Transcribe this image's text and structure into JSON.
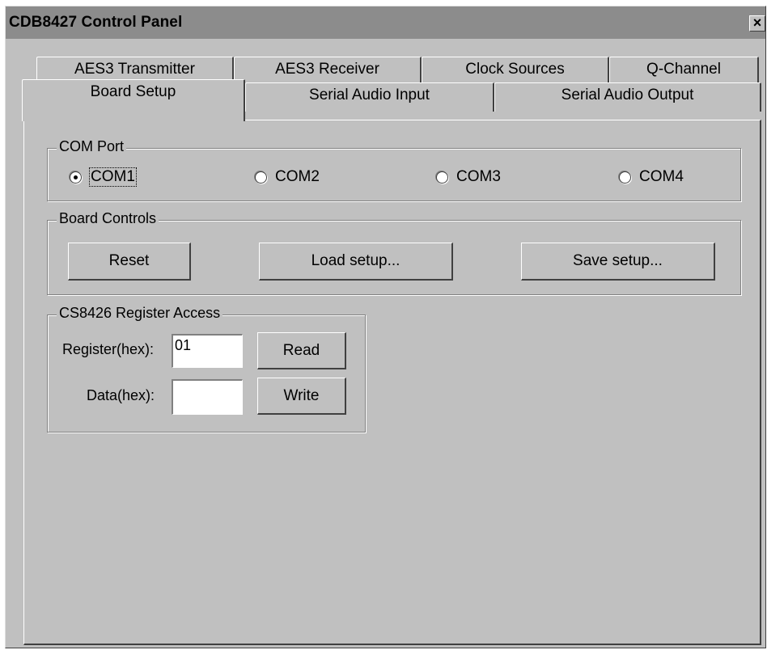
{
  "window": {
    "title": "CDB8427 Control Panel",
    "close_glyph": "×"
  },
  "tabs": {
    "back_row": [
      "AES3 Transmitter",
      "AES3 Receiver",
      "Clock Sources",
      "Q-Channel"
    ],
    "front_row": [
      "Board Setup",
      "Serial Audio Input",
      "Serial Audio Output"
    ],
    "active": "Board Setup"
  },
  "com_port": {
    "label": "COM Port",
    "options": [
      "COM1",
      "COM2",
      "COM3",
      "COM4"
    ],
    "selected": "COM1"
  },
  "board_controls": {
    "label": "Board Controls",
    "reset_label": "Reset",
    "load_label": "Load setup...",
    "save_label": "Save setup..."
  },
  "register_access": {
    "label": "CS8426 Register Access",
    "register_label": "Register(hex):",
    "register_value": "01",
    "data_label": "Data(hex):",
    "data_value": "",
    "read_label": "Read",
    "write_label": "Write"
  }
}
